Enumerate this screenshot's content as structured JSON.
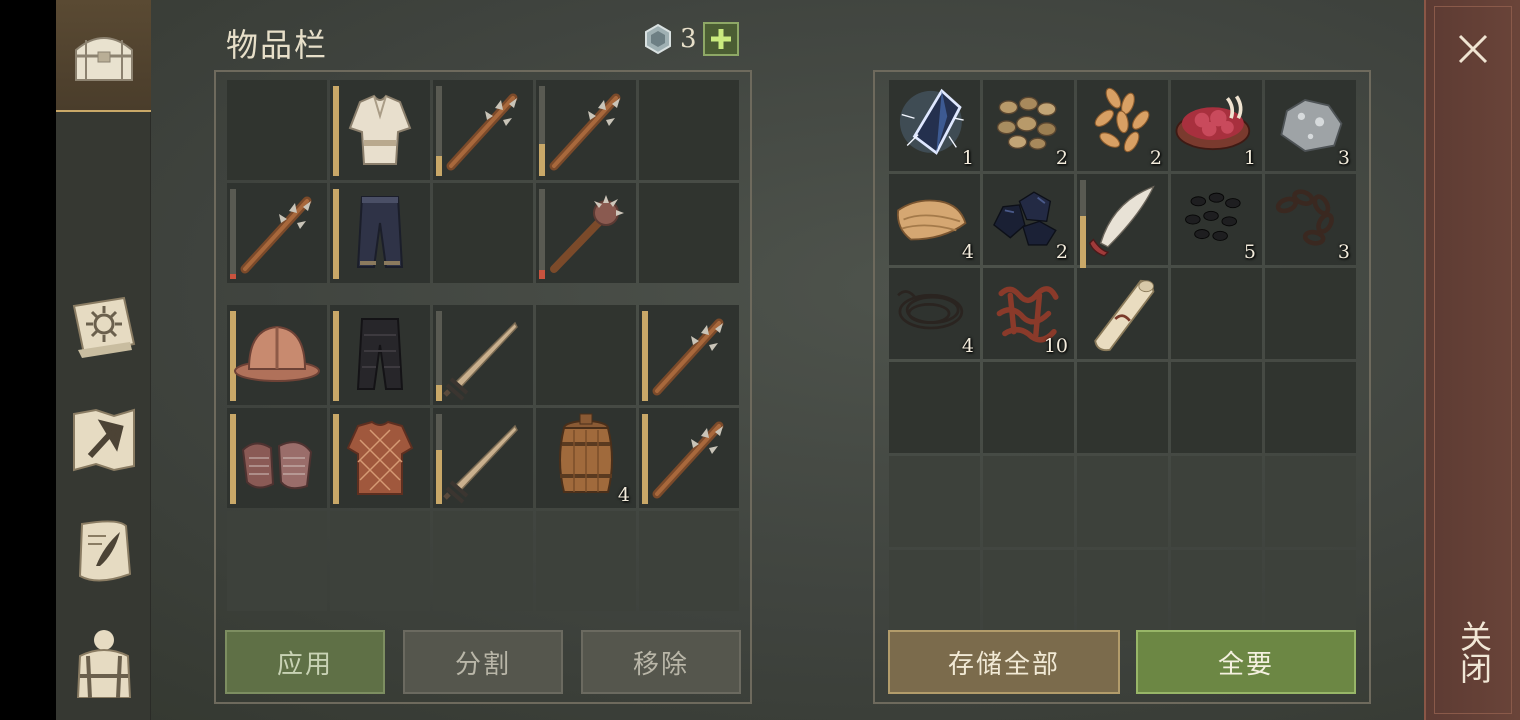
{
  "title": "物品栏",
  "currency": {
    "icon": "gem-coin-icon",
    "amount": "3",
    "add_icon": "plus-icon"
  },
  "nav": [
    {
      "name": "chest-icon",
      "active": true
    },
    {
      "name": "sun-book-icon",
      "active": false
    },
    {
      "name": "crafting-map-icon",
      "active": false
    },
    {
      "name": "quest-scroll-icon",
      "active": false
    },
    {
      "name": "backpack-icon",
      "active": false
    }
  ],
  "inventory": {
    "grid_a": [
      {
        "icon": "empty"
      },
      {
        "icon": "shirt-icon",
        "durability": 1.0
      },
      {
        "icon": "spiked-club-icon",
        "durability": 0.22
      },
      {
        "icon": "spiked-club-icon",
        "durability": 0.36
      },
      {
        "icon": "empty"
      },
      {
        "icon": "spiked-club-icon",
        "durability": 0.06
      },
      {
        "icon": "pants-icon",
        "durability": 1.0
      },
      {
        "icon": "empty"
      },
      {
        "icon": "mace-icon",
        "durability": 0.1
      },
      {
        "icon": "empty"
      }
    ],
    "grid_b": [
      {
        "icon": "helmet-icon",
        "durability": 1.0
      },
      {
        "icon": "pants-dark-icon",
        "durability": 1.0
      },
      {
        "icon": "sword-icon",
        "durability": 0.18
      },
      {
        "icon": "empty"
      },
      {
        "icon": "spiked-club-icon",
        "durability": 1.0
      },
      {
        "icon": "chain-gloves-icon",
        "durability": 1.0
      },
      {
        "icon": "padded-armor-icon",
        "durability": 1.0
      },
      {
        "icon": "sword-icon",
        "durability": 0.6
      },
      {
        "icon": "barrel-icon",
        "qty": "4"
      },
      {
        "icon": "spiked-club-icon",
        "durability": 1.0
      },
      {
        "icon": "empty",
        "dim": true
      },
      {
        "icon": "empty",
        "dim": true
      },
      {
        "icon": "empty",
        "dim": true
      },
      {
        "icon": "empty",
        "dim": true
      },
      {
        "icon": "empty",
        "dim": true
      }
    ]
  },
  "storage": [
    {
      "icon": "crystal-icon",
      "qty": "1"
    },
    {
      "icon": "stones-icon",
      "qty": "2"
    },
    {
      "icon": "grain-icon",
      "qty": "2"
    },
    {
      "icon": "raw-meat-icon",
      "qty": "1"
    },
    {
      "icon": "iron-ore-icon",
      "qty": "3"
    },
    {
      "icon": "cloth-icon",
      "qty": "4"
    },
    {
      "icon": "coal-icon",
      "qty": "2"
    },
    {
      "icon": "sabre-icon",
      "durability": 0.6
    },
    {
      "icon": "black-seeds-icon",
      "qty": "5"
    },
    {
      "icon": "chain-icon",
      "qty": "3"
    },
    {
      "icon": "rope-icon",
      "qty": "4"
    },
    {
      "icon": "guts-icon",
      "qty": "10"
    },
    {
      "icon": "scroll-icon"
    },
    {
      "icon": "empty"
    },
    {
      "icon": "empty"
    },
    {
      "icon": "empty"
    },
    {
      "icon": "empty"
    },
    {
      "icon": "empty"
    },
    {
      "icon": "empty"
    },
    {
      "icon": "empty"
    },
    {
      "icon": "empty",
      "dim": true
    },
    {
      "icon": "empty",
      "dim": true
    },
    {
      "icon": "empty",
      "dim": true
    },
    {
      "icon": "empty",
      "dim": true
    },
    {
      "icon": "empty",
      "dim": true
    },
    {
      "icon": "empty",
      "dim": true
    },
    {
      "icon": "empty",
      "dim": true
    },
    {
      "icon": "empty",
      "dim": true
    },
    {
      "icon": "empty",
      "dim": true
    },
    {
      "icon": "empty",
      "dim": true
    }
  ],
  "buttons": {
    "apply": "应用",
    "split": "分割",
    "remove": "移除",
    "store_all": "存储全部",
    "take_all": "全要"
  },
  "close": {
    "icon": "close-icon",
    "label": "关闭"
  },
  "colors": {
    "durability_high": "#c9a868",
    "durability_low": "#c9533e",
    "accent_green": "#6c8744",
    "accent_gold": "#b29c6b"
  }
}
